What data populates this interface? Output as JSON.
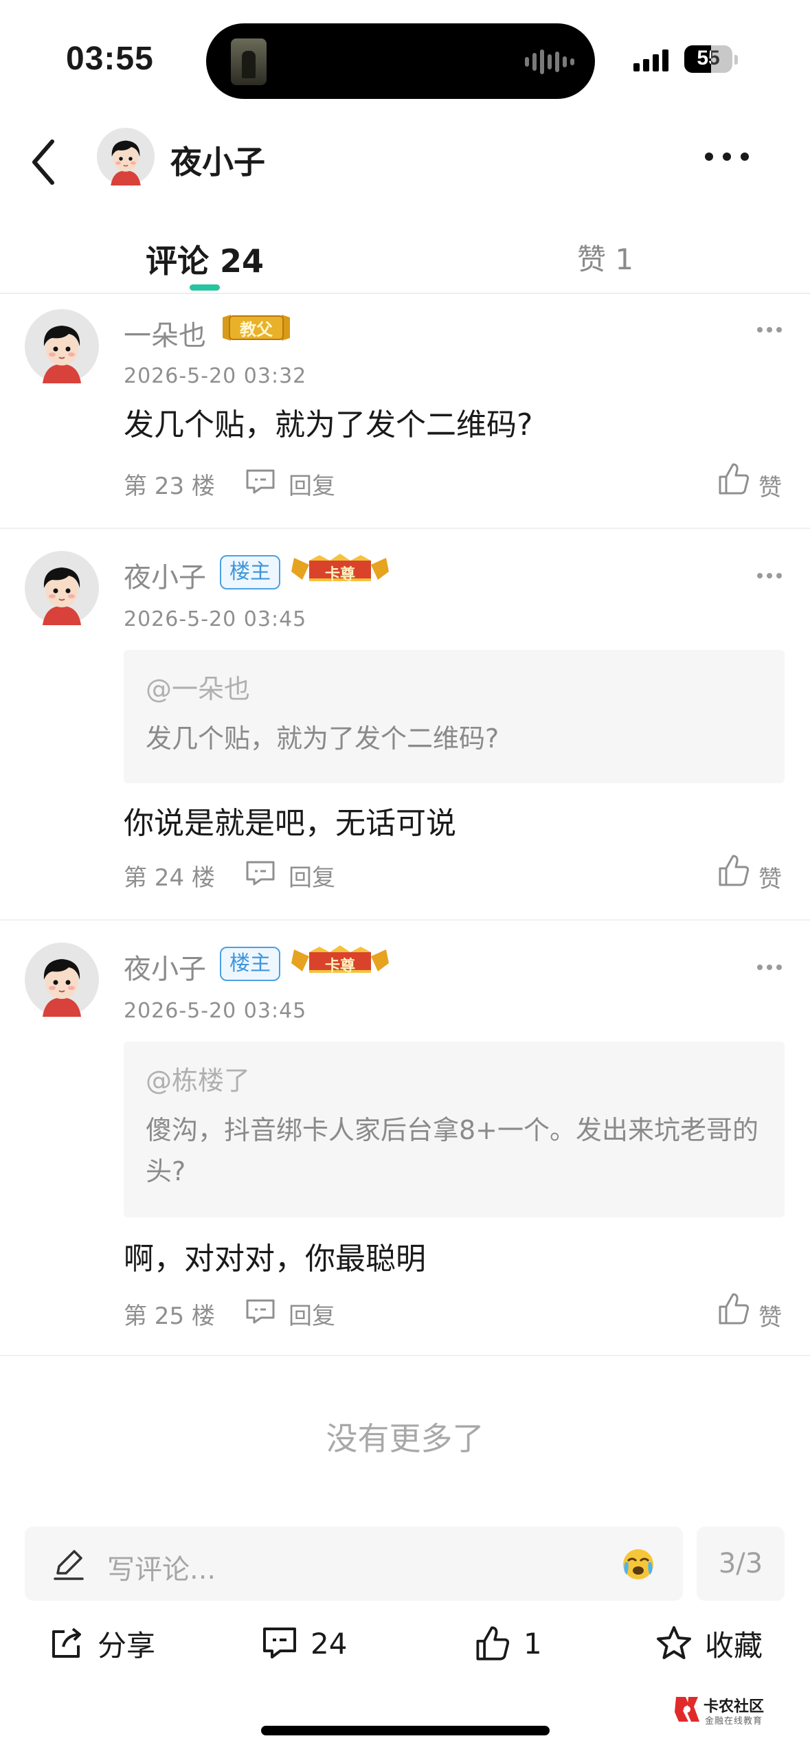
{
  "status_bar": {
    "time": "03:55",
    "battery": "55",
    "battery_level": 0.55
  },
  "header": {
    "name": "夜小子"
  },
  "tabs": {
    "comments_label": "评论 24",
    "likes_label": "赞 1"
  },
  "comments": [
    {
      "user": "一朵也",
      "badge": "教父",
      "time": "2026-5-20 03:32",
      "text": "发几个贴，就为了发个二维码?",
      "floor": "第 23 楼",
      "reply_label": "回复",
      "like_label": "赞"
    },
    {
      "user": "夜小子",
      "owner_badge": "楼主",
      "badge": "卡尊",
      "time": "2026-5-20 03:45",
      "quote_user": "@一朵也",
      "quote_text": "发几个贴，就为了发个二维码?",
      "text": "你说是就是吧，无话可说",
      "floor": "第 24 楼",
      "reply_label": "回复",
      "like_label": "赞"
    },
    {
      "user": "夜小子",
      "owner_badge": "楼主",
      "badge": "卡尊",
      "time": "2026-5-20 03:45",
      "quote_user": "@栋楼了",
      "quote_text": "傻沟，抖音绑卡人家后台拿8+一个。发出来坑老哥的头?",
      "text": "啊，对对对，你最聪明",
      "floor": "第 25 楼",
      "reply_label": "回复",
      "like_label": "赞"
    }
  ],
  "no_more_text": "没有更多了",
  "composer": {
    "placeholder": "写评论...",
    "page": "3/3"
  },
  "actions": {
    "share": "分享",
    "comments": "24",
    "likes": "1",
    "favorite": "收藏"
  },
  "watermark": {
    "title": "卡农社区",
    "subtitle": "金融在线教育"
  },
  "colors": {
    "accent": "#27c4a0",
    "owner_badge": "#3e96dc",
    "text_primary": "#1a1a1a",
    "text_secondary": "#8f8f8f"
  }
}
